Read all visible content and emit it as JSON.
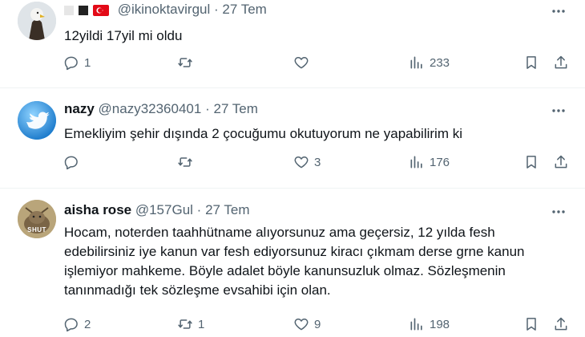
{
  "tweets": [
    {
      "handle": "@ikinoktavirgul",
      "dot": "·",
      "date": "27 Tem",
      "text": "12yildi 17yil mi oldu",
      "replies": "1",
      "retweets": "",
      "likes": "",
      "views": "233"
    },
    {
      "name": "nazy",
      "handle": "@nazy32360401",
      "dot": "·",
      "date": "27 Tem",
      "text": "Emekliyim şehir dışında 2 çocuğumu okutuyorum ne yapabilirim ki",
      "replies": "",
      "retweets": "",
      "likes": "3",
      "views": "176"
    },
    {
      "name": "aisha rose",
      "handle": "@157Gul",
      "dot": "·",
      "date": "27 Tem",
      "avatar_text": "SHUT",
      "text": "Hocam, noterden taahhütname alıyorsunuz ama geçersiz, 12 yılda fesh edebilirsiniz iye kanun var fesh ediyorsunuz kiracı çıkmam derse grne kanun işlemiyor mahkeme.  Böyle adalet böyle kanunsuzluk olmaz.  Sözleşmenin tanınmadığı tek sözleşme evsahibi için olan.",
      "replies": "2",
      "retweets": "1",
      "likes": "9",
      "views": "198"
    }
  ],
  "colors": {
    "text": "#0f1419",
    "muted": "#536471",
    "separator": "#eff3f4",
    "flag_red": "#e30a17"
  },
  "icons": [
    "more-icon",
    "reply-icon",
    "retweet-icon",
    "like-icon",
    "views-icon",
    "bookmark-icon",
    "share-icon"
  ]
}
